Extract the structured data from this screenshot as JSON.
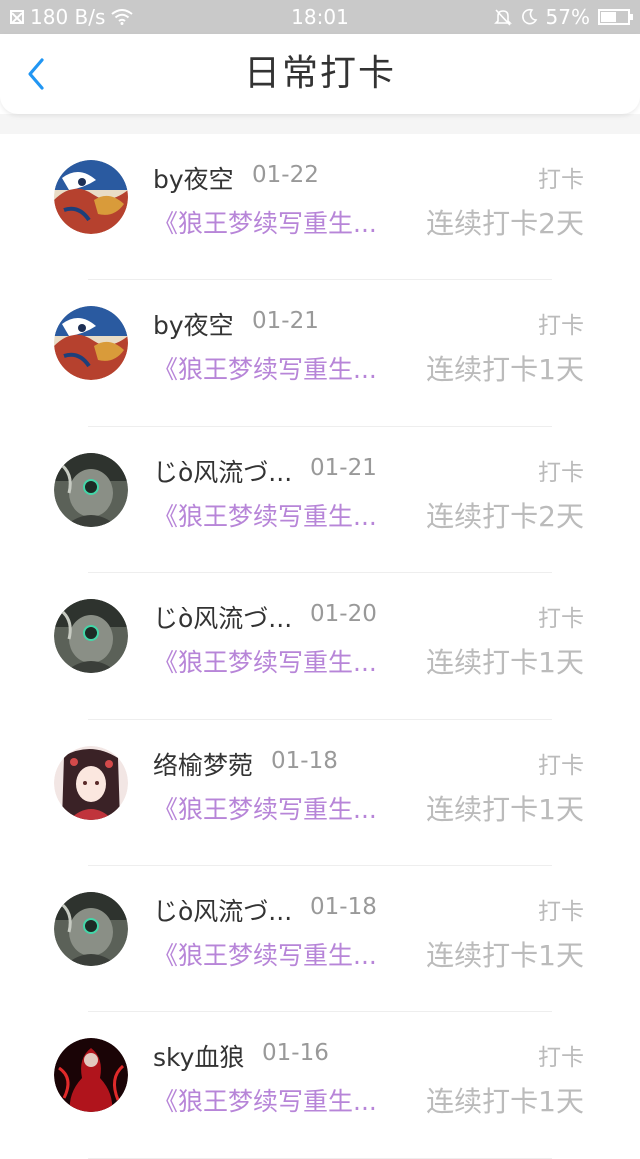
{
  "status_bar": {
    "speed": "180 B/s",
    "time": "18:01",
    "battery": "57%",
    "battery_level": 0.57,
    "icons": [
      "no-sim-icon",
      "wifi-icon",
      "bell-off-icon",
      "moon-icon",
      "battery-icon"
    ]
  },
  "header": {
    "title": "日常打卡",
    "back_icon": "chevron-left-icon",
    "accent_color": "#2196f3"
  },
  "colors": {
    "book_title": "#b785d8",
    "muted": "#bbbbbb",
    "name": "#333333"
  },
  "entries": [
    {
      "user": "by夜空",
      "date": "01-22",
      "action": "打卡",
      "book": "《狼王梦续写重生...",
      "streak": "连续打卡2天",
      "avatar": "avatar-dragon"
    },
    {
      "user": "by夜空",
      "date": "01-21",
      "action": "打卡",
      "book": "《狼王梦续写重生...",
      "streak": "连续打卡1天",
      "avatar": "avatar-dragon"
    },
    {
      "user": "じò风流づ...",
      "date": "01-21",
      "action": "打卡",
      "book": "《狼王梦续写重生...",
      "streak": "连续打卡2天",
      "avatar": "avatar-mask"
    },
    {
      "user": "じò风流づ...",
      "date": "01-20",
      "action": "打卡",
      "book": "《狼王梦续写重生...",
      "streak": "连续打卡1天",
      "avatar": "avatar-mask"
    },
    {
      "user": "络榆梦菀",
      "date": "01-18",
      "action": "打卡",
      "book": "《狼王梦续写重生...",
      "streak": "连续打卡1天",
      "avatar": "avatar-anime-girl"
    },
    {
      "user": "じò风流づ...",
      "date": "01-18",
      "action": "打卡",
      "book": "《狼王梦续写重生...",
      "streak": "连续打卡1天",
      "avatar": "avatar-mask"
    },
    {
      "user": "sky血狼",
      "date": "01-16",
      "action": "打卡",
      "book": "《狼王梦续写重生...",
      "streak": "连续打卡1天",
      "avatar": "avatar-red-figure"
    }
  ]
}
